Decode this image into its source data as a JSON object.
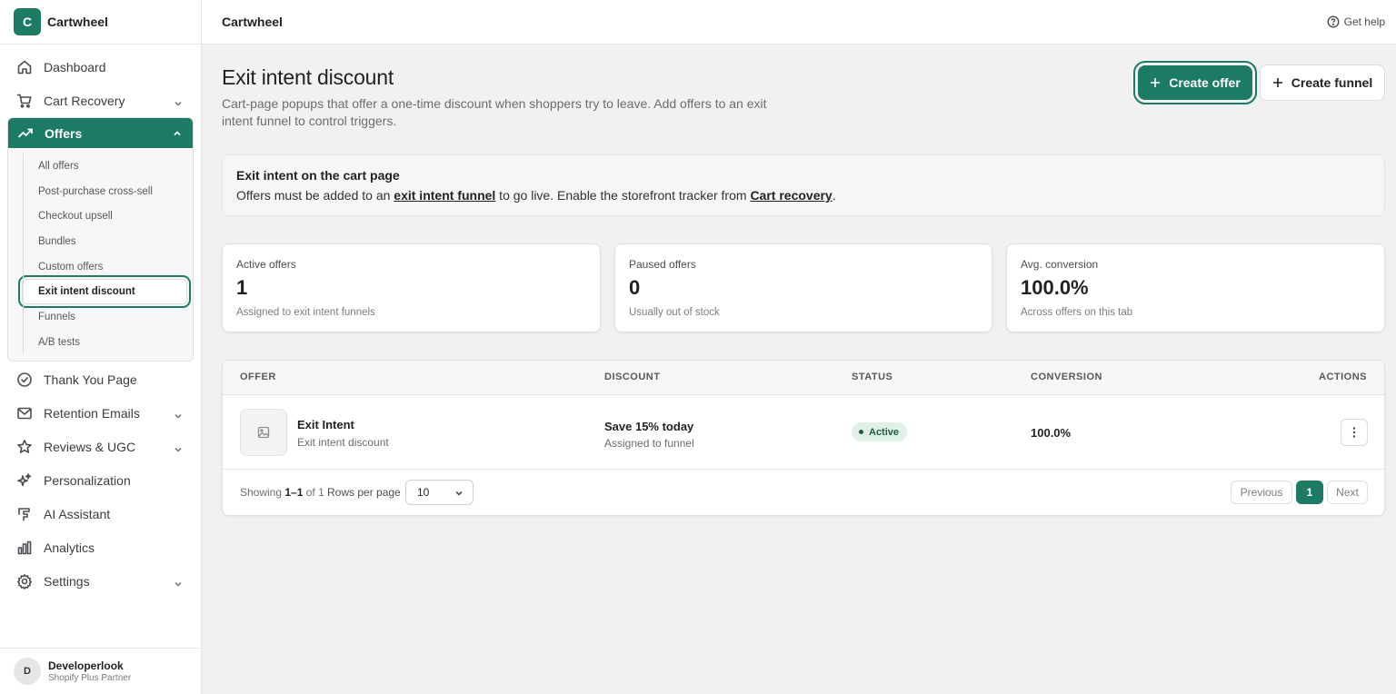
{
  "brand": {
    "logo_letter": "C",
    "name": "Cartwheel"
  },
  "nav": {
    "items_top": [
      {
        "label": "Dashboard",
        "icon": "home-icon"
      },
      {
        "label": "Cart Recovery",
        "icon": "cart-icon",
        "has_chevron": true
      }
    ],
    "offers": {
      "label": "Offers",
      "icon": "trending-up-icon",
      "subitems": [
        "All offers",
        "Post-purchase cross-sell",
        "Checkout upsell",
        "Bundles",
        "Custom offers",
        "Exit intent discount",
        "Funnels",
        "A/B tests"
      ],
      "active_subitem": "Exit intent discount"
    },
    "items_bottom": [
      {
        "label": "Thank You Page",
        "icon": "check-circle-icon"
      },
      {
        "label": "Retention Emails",
        "icon": "mail-icon",
        "has_chevron": true
      },
      {
        "label": "Reviews & UGC",
        "icon": "star-icon",
        "has_chevron": true
      },
      {
        "label": "Personalization",
        "icon": "sparkle-icon"
      },
      {
        "label": "AI Assistant",
        "icon": "ai-assistant-icon"
      },
      {
        "label": "Analytics",
        "icon": "bar-chart-icon"
      },
      {
        "label": "Settings",
        "icon": "gear-icon",
        "has_chevron": true
      }
    ]
  },
  "user": {
    "initial": "D",
    "name": "Developerlook",
    "role": "Shopify Plus Partner"
  },
  "topbar": {
    "title": "Cartwheel",
    "help": "Get help"
  },
  "page": {
    "title": "Exit intent discount",
    "description": "Cart-page popups that offer a one-time discount when shoppers try to leave. Add offers to an exit intent funnel to control triggers.",
    "primary_button": "Create offer",
    "secondary_button": "Create funnel"
  },
  "banner": {
    "title": "Exit intent on the cart page",
    "text_1": "Offers must be added to an ",
    "link_1": "exit intent funnel",
    "text_2": " to go live. Enable the storefront tracker from ",
    "link_2": "Cart recovery",
    "text_3": "."
  },
  "stats": [
    {
      "label": "Active offers",
      "value": "1",
      "sub": "Assigned to exit intent funnels"
    },
    {
      "label": "Paused offers",
      "value": "0",
      "sub": "Usually out of stock"
    },
    {
      "label": "Avg. conversion",
      "value": "100.0%",
      "sub": "Across offers on this tab"
    }
  ],
  "table": {
    "headers": {
      "offer": "OFFER",
      "discount": "DISCOUNT",
      "status": "STATUS",
      "conversion": "CONVERSION",
      "actions": "ACTIONS"
    },
    "rows": [
      {
        "name": "Exit Intent",
        "type": "Exit intent discount",
        "discount": "Save 15% today",
        "discount_sub": "Assigned to funnel",
        "status": "Active",
        "conversion": "100.0%"
      }
    ],
    "footer": {
      "showing_prefix": "Showing ",
      "showing_range": "1–1",
      "showing_suffix": " of 1",
      "rows_per_page_label": "Rows per page",
      "rows_per_page_value": "10",
      "previous": "Previous",
      "page": "1",
      "next": "Next"
    }
  },
  "colors": {
    "accent": "#1d7a64",
    "badge_bg": "#dff0e6"
  }
}
